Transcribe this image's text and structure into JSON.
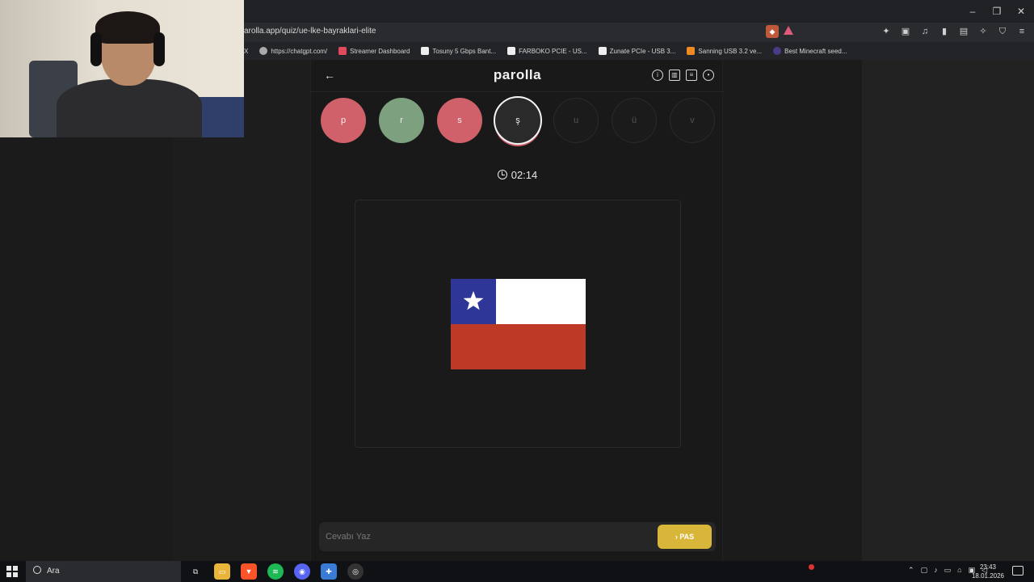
{
  "browser": {
    "url": "arolla.app/quiz/ue-lke-bayraklari-elite",
    "window_controls": [
      "–",
      "❐",
      "✕"
    ],
    "bookmarks": [
      {
        "label": "X",
        "icon": "x-icon"
      },
      {
        "label": "https://chatgpt.com/",
        "icon": "globe-icon"
      },
      {
        "label": "Streamer Dashboard",
        "icon": "streamer-icon"
      },
      {
        "label": "Tosuny 5 Gbps Bant...",
        "icon": "amazon-icon"
      },
      {
        "label": "FARBOKO PCIE - US...",
        "icon": "amazon-icon"
      },
      {
        "label": "Zunate PCIe - USB 3...",
        "icon": "amazon-icon"
      },
      {
        "label": "Sanning USB 3.2 ve...",
        "icon": "hb-icon"
      },
      {
        "label": "Best Minecraft seed...",
        "icon": "minecraft-icon"
      }
    ]
  },
  "app": {
    "logo": "parolla",
    "back_icon": "←",
    "header_icons": [
      "info-icon",
      "stats-icon",
      "message-icon",
      "profile-icon"
    ]
  },
  "letters": [
    {
      "char": "p",
      "state": "wrong"
    },
    {
      "char": "r",
      "state": "right"
    },
    {
      "char": "s",
      "state": "wrong"
    },
    {
      "char": "ş",
      "state": "active"
    },
    {
      "char": "u",
      "state": "pending"
    },
    {
      "char": "ü",
      "state": "pending"
    },
    {
      "char": "v",
      "state": "pending"
    }
  ],
  "timer": "02:14",
  "question": {
    "image": "flag-chile"
  },
  "answer": {
    "placeholder": "Cevabı Yaz",
    "value": ""
  },
  "pass_button": "› PAS",
  "colors": {
    "wrong": "#d0606a",
    "right": "#7da17f",
    "pass": "#d8b63a",
    "flag_blue": "#2e3797",
    "flag_red": "#be3a26"
  },
  "taskbar": {
    "search_placeholder": "Ara",
    "time": "23:43",
    "date": "18.01.2026",
    "apps": [
      "taskview-icon",
      "file-explorer-icon",
      "brave-icon",
      "spotify-icon",
      "discord-icon",
      "app-icon",
      "obs-icon"
    ]
  }
}
